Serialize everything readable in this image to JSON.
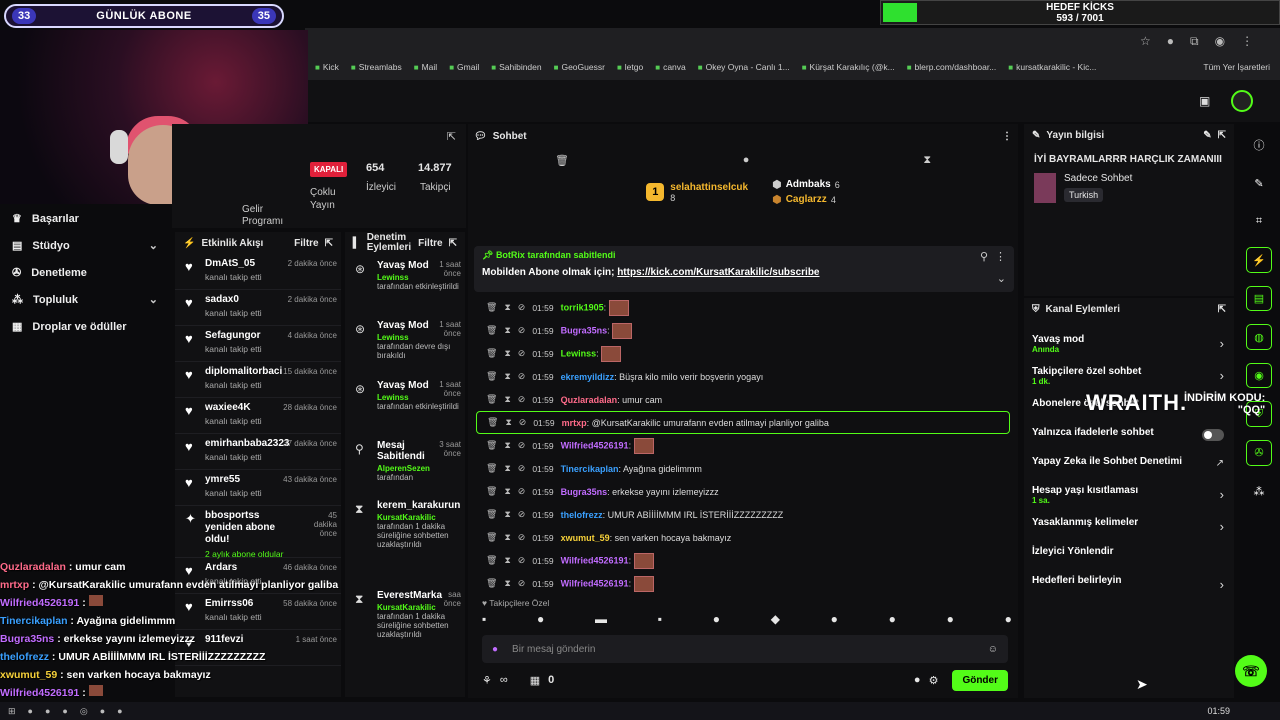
{
  "overlay": {
    "sub_goal_left": "33",
    "sub_goal_title": "GÜNLÜK ABONE",
    "sub_goal_right": "35",
    "kicks_title": "HEDEF KİCKS",
    "kicks_count": "593 / 7001",
    "kicks_progress": 0.085,
    "wraith": "WRAITH.",
    "wraith_code": "İNDİRİM KODU:\n\"QQ\""
  },
  "browser": {
    "bookmarks": [
      "Kick",
      "Streamlabs",
      "Mail",
      "Gmail",
      "Sahibinden",
      "GeoGuessr",
      "letgo",
      "canva",
      "Okey Oyna - Canlı 1...",
      "Kürşat Karakılıç (@k...",
      "blerp.com/dashboar...",
      "kursatkarakilic - Kic..."
    ],
    "all_bookmarks": "Tüm Yer İşaretleri"
  },
  "nav": {
    "items": [
      {
        "label": "Başarılar",
        "chev": ""
      },
      {
        "label": "Stüdyo",
        "chev": "⌄"
      },
      {
        "label": "Denetleme",
        "chev": ""
      },
      {
        "label": "Topluluk",
        "chev": "⌄"
      },
      {
        "label": "Droplar ve ödüller",
        "chev": ""
      }
    ]
  },
  "stats": {
    "status": "KAPALI",
    "viewers": "654",
    "viewers_label": "İzleyici",
    "followers": "14.877",
    "followers_label": "Takipçi",
    "multi": "Çoklu Yayın",
    "income": "Gelir Programı"
  },
  "activity": {
    "title": "Etkinlik Akışı",
    "filter": "Filtre",
    "rows": [
      {
        "name": "DmAtS_05",
        "sub": "kanalı takip etti",
        "time": "2 dakika önce"
      },
      {
        "name": "sadax0",
        "sub": "kanalı takip etti",
        "time": "2 dakika önce"
      },
      {
        "name": "Sefagungor",
        "sub": "kanalı takip etti",
        "time": "4 dakika önce"
      },
      {
        "name": "diplomalitorbaci",
        "sub": "kanalı takip etti",
        "time": "15 dakika önce"
      },
      {
        "name": "waxiee4K",
        "sub": "kanalı takip etti",
        "time": "28 dakika önce"
      },
      {
        "name": "emirhanbaba2323",
        "sub": "kanalı takip etti",
        "time": "37 dakika önce"
      },
      {
        "name": "ymre55",
        "sub": "kanalı takip etti",
        "time": "43 dakika önce"
      },
      {
        "name": "bbosportss yeniden abone oldu!",
        "sub": "2 aylık abone oldular",
        "time": "45 dakika önce"
      },
      {
        "name": "Ardars",
        "sub": "kanalı takip etti",
        "time": "46 dakika önce"
      },
      {
        "name": "Emirrss06",
        "sub": "kanalı takip etti",
        "time": "58 dakika önce"
      },
      {
        "name": "911fevzi",
        "sub": "",
        "time": "1 saat önce"
      }
    ]
  },
  "modlog": {
    "title": "Denetim Eylemleri",
    "filter": "Filtre",
    "rows": [
      {
        "name": "Yavaş Mod",
        "who": "Lewinss",
        "desc": "tarafından etkinleştirildi",
        "time": "1 saat önce"
      },
      {
        "name": "Yavaş Mod",
        "who": "Lewinss",
        "desc": "tarafından devre dışı bırakıldı",
        "time": "1 saat önce"
      },
      {
        "name": "Yavaş Mod",
        "who": "Lewinss",
        "desc": "tarafından etkinleştirildi",
        "time": "1 saat önce"
      },
      {
        "name": "Mesaj Sabitlendi",
        "who": "AlperenSezen",
        "desc": "tarafından",
        "time": "3 saat önce"
      },
      {
        "name": "kerem_karakurun",
        "who": "KursatKarakilic",
        "desc": "tarafından 1 dakika süreliğine sohbetten uzaklaştırıldı",
        "time": ""
      },
      {
        "name": "EverestMarka",
        "who": "KursatKarakilic",
        "desc": "tarafından 1 dakika süreliğine sohbetten uzaklaştırıldı",
        "time": "saa önce"
      }
    ]
  },
  "chat": {
    "title": "Sohbet",
    "podium": [
      {
        "name": "selahattinselcuk",
        "count": "8"
      },
      {
        "name": "Admbaks",
        "count": "6"
      },
      {
        "name": "Caglarzz",
        "count": "4"
      }
    ],
    "pinned_by": "BotRix tarafından sabitlendi",
    "pinned_msg": "Mobilden Abone olmak için;",
    "pinned_link": "https://kick.com/KursatKarakilic/subscribe",
    "messages": [
      {
        "time": "01:59",
        "user": "torrik1905",
        "color": "#53fc18",
        "text": "",
        "emote": true
      },
      {
        "time": "01:59",
        "user": "Bugra35ns",
        "color": "#c16cff",
        "text": "",
        "emote": true
      },
      {
        "time": "01:59",
        "user": "Lewinss",
        "color": "#53fc18",
        "text": "",
        "emote": true
      },
      {
        "time": "01:59",
        "user": "ekremyildizz",
        "color": "#3aa0ff",
        "text": "Büşra kilo milo verir boşverin yogayı",
        "emote": false
      },
      {
        "time": "01:59",
        "user": "Quzlaradalan",
        "color": "#ff6b8a",
        "text": "umur cam",
        "emote": false
      },
      {
        "time": "01:59",
        "user": "mrtxp",
        "color": "#ff6b8a",
        "text": "@KursatKarakilic umurafann evden atilmayi planliyor galiba",
        "emote": false,
        "highlight": true
      },
      {
        "time": "01:59",
        "user": "Wilfried4526191",
        "color": "#c16cff",
        "text": "",
        "emote": true
      },
      {
        "time": "01:59",
        "user": "Tinercikaplan",
        "color": "#3aa0ff",
        "text": "Ayağına gidelimmm",
        "emote": false
      },
      {
        "time": "01:59",
        "user": "Bugra35ns",
        "color": "#c16cff",
        "text": "erkekse yayını izlemeyizzz",
        "emote": false
      },
      {
        "time": "01:59",
        "user": "thelofrezz",
        "color": "#3aa0ff",
        "text": "UMUR ABİİİİMMM IRL İSTERİİİZZZZZZZZZ",
        "emote": false
      },
      {
        "time": "01:59",
        "user": "xwumut_59",
        "color": "#f5d03a",
        "text": "sen varken hocaya bakmayız",
        "emote": false
      },
      {
        "time": "01:59",
        "user": "Wilfried4526191",
        "color": "#c16cff",
        "text": "",
        "emote": true
      },
      {
        "time": "01:59",
        "user": "Wilfried4526191",
        "color": "#c16cff",
        "text": "",
        "emote": true
      }
    ],
    "follower_only": "Takipçilere Özel",
    "input_placeholder": "Bir mesaj gönderin",
    "points": "0",
    "send": "Gönder"
  },
  "overlay_chat": [
    {
      "user": "Quzlaradalan",
      "color": "#ff6b8a",
      "text": "umur cam"
    },
    {
      "user": "mrtxp",
      "color": "#ff6b8a",
      "text": "@KursatKarakilic umurafann evden atilmayi planliyor galiba"
    },
    {
      "user": "Wilfried4526191",
      "color": "#c16cff",
      "text": ""
    },
    {
      "user": "Tinercikaplan",
      "color": "#3aa0ff",
      "text": "Ayağına gidelimmm"
    },
    {
      "user": "Bugra35ns",
      "color": "#c16cff",
      "text": "erkekse yayını izlemeyizzz"
    },
    {
      "user": "thelofrezz",
      "color": "#3aa0ff",
      "text": "UMUR ABİİİİMMM IRL İSTERİİİZZZZZZZZZ"
    },
    {
      "user": "xwumut_59",
      "color": "#f5d03a",
      "text": "sen varken hocaya bakmayız"
    },
    {
      "user": "Wilfried4526191",
      "color": "#c16cff",
      "text": ""
    }
  ],
  "stream_info": {
    "title": "Yayın bilgisi",
    "stream_title": "İYİ BAYRAMLARRR HARÇLIK ZAMANIII",
    "category": "Sadece Sohbet",
    "language": "Turkish"
  },
  "channel_actions": {
    "title": "Kanal Eylemleri",
    "rows": [
      {
        "label": "Yavaş mod",
        "sub": "Anında",
        "type": "chev"
      },
      {
        "label": "Takipçilere özel sohbet",
        "sub": "1 dk.",
        "type": "chev"
      },
      {
        "label": "Abonelere özel sohbet",
        "sub": "",
        "type": "none"
      },
      {
        "label": "Yalnızca ifadelerle sohbet",
        "sub": "",
        "type": "toggle"
      },
      {
        "label": "Yapay Zeka ile Sohbet Denetimi",
        "sub": "",
        "type": "ext"
      },
      {
        "label": "Hesap yaşı kısıtlaması",
        "sub": "1 sa.",
        "type": "chev"
      },
      {
        "label": "Yasaklanmış kelimeler",
        "sub": "",
        "type": "chev"
      },
      {
        "label": "İzleyici Yönlendir",
        "sub": "",
        "type": "none"
      },
      {
        "label": "Hedefleri belirleyin",
        "sub": "",
        "type": "chev"
      }
    ]
  },
  "taskbar": {
    "clock": "01:59"
  }
}
